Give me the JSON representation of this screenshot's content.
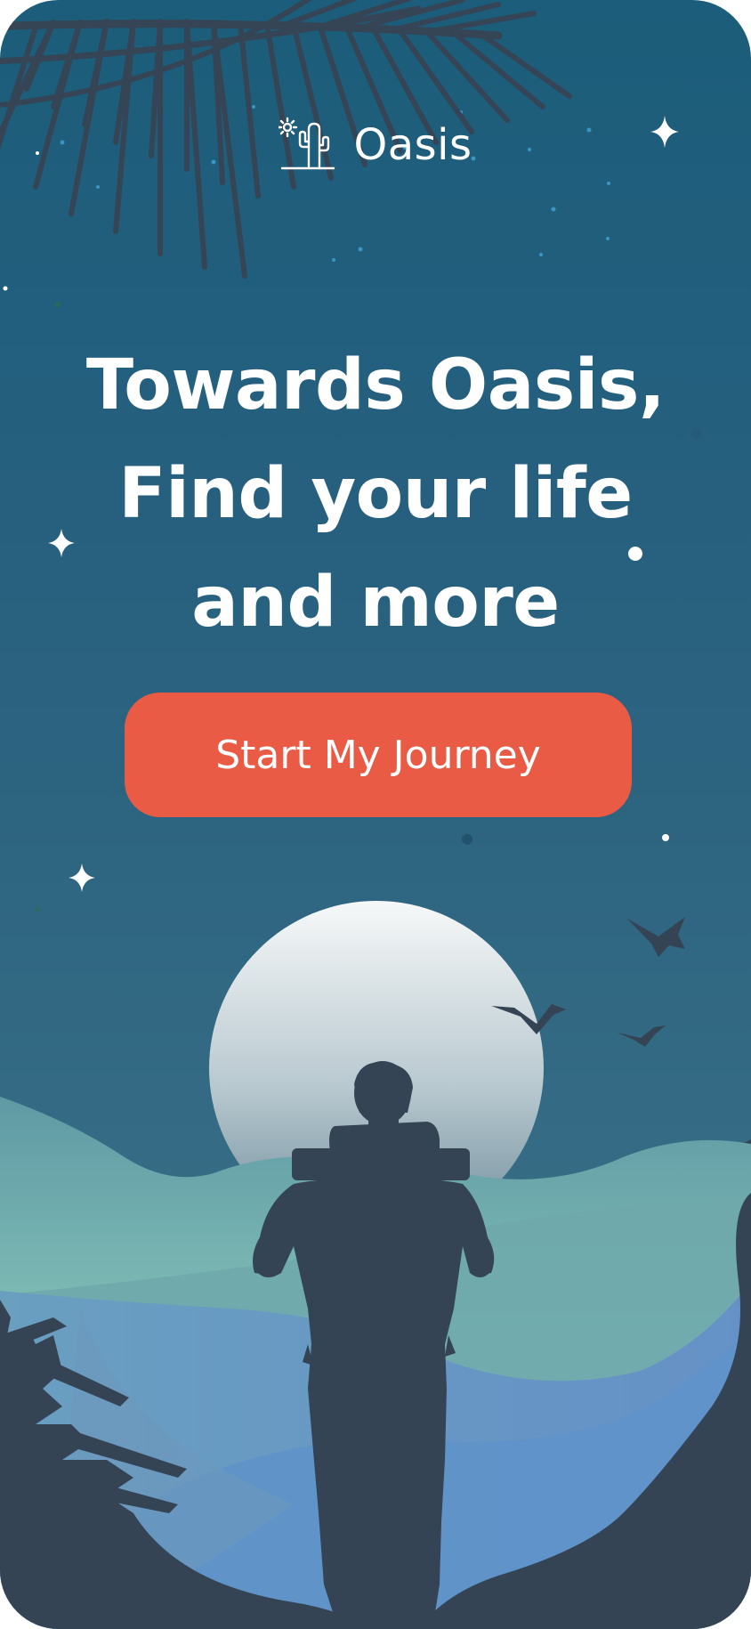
{
  "app": {
    "name": "Oasis"
  },
  "hero": {
    "line1": "Towards Oasis,",
    "line2": "Find your life",
    "line3": "and more"
  },
  "cta": {
    "label": "Start My Journey"
  },
  "colors": {
    "sky_top": "#1b5d7a",
    "sky_bottom": "#3d7086",
    "accent": "#e95b44",
    "silhouette": "#344454",
    "hills_teal": "#7fc0b7",
    "hills_blue": "#6394c8"
  },
  "icons": {
    "logo": "cactus-sun-icon",
    "stars": "sparkle-icon",
    "birds": "bird-icon"
  }
}
